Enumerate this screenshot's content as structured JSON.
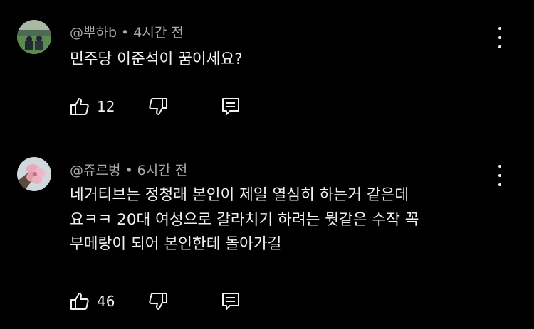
{
  "comments": [
    {
      "author": "@뿌하b",
      "separator": "•",
      "time": "4시간 전",
      "text": "민주당 이준석이 꿈이세요?",
      "likes": "12",
      "avatar": "landscape-photo"
    },
    {
      "author": "@쥬르벙",
      "separator": "•",
      "time": "6시간 전",
      "text_lines": [
        "네거티브는 정청래 본인이 제일 열심히 하는거 같은데",
        "요ㅋㅋ 20대 여성으로 갈라치기 하려는 뭣같은 수작 꼭",
        "부메랑이 되어 본인한테 돌아가길"
      ],
      "likes": "46",
      "avatar": "flower-photo"
    }
  ],
  "colors": {
    "background": "#000000",
    "text": "#f1f1f1",
    "meta": "#aaaaaa"
  }
}
